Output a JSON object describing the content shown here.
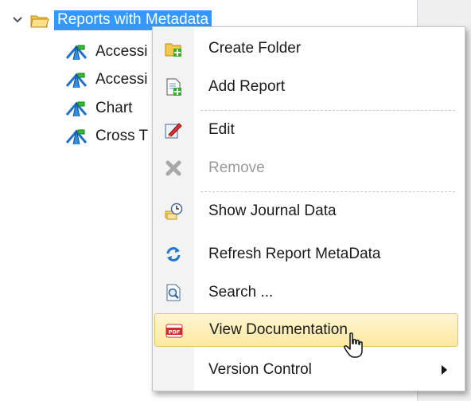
{
  "tree": {
    "root_label": "Reports with Metadata",
    "items": [
      {
        "label": "Accessi"
      },
      {
        "label": "Accessi"
      },
      {
        "label": "Chart"
      },
      {
        "label": "Cross T"
      }
    ]
  },
  "context_menu": {
    "items": [
      {
        "label": "Create Folder",
        "icon": "new-folder-icon"
      },
      {
        "label": "Add Report",
        "icon": "add-report-icon"
      },
      {
        "label": "Edit",
        "icon": "edit-icon"
      },
      {
        "label": "Remove",
        "icon": "remove-icon",
        "disabled": true
      },
      {
        "label": "Show Journal Data",
        "icon": "journal-clock-icon"
      },
      {
        "label": "Refresh Report MetaData",
        "icon": "refresh-icon"
      },
      {
        "label": "Search ...",
        "icon": "search-document-icon"
      },
      {
        "label": "View Documentation",
        "icon": "pdf-icon",
        "highlighted": true
      },
      {
        "label": "Version Control",
        "icon": "",
        "has_submenu": true
      }
    ]
  },
  "colors": {
    "selection": "#3399ff",
    "menu_hover_top": "#fff6d1",
    "menu_hover_bottom": "#fde8a2"
  }
}
